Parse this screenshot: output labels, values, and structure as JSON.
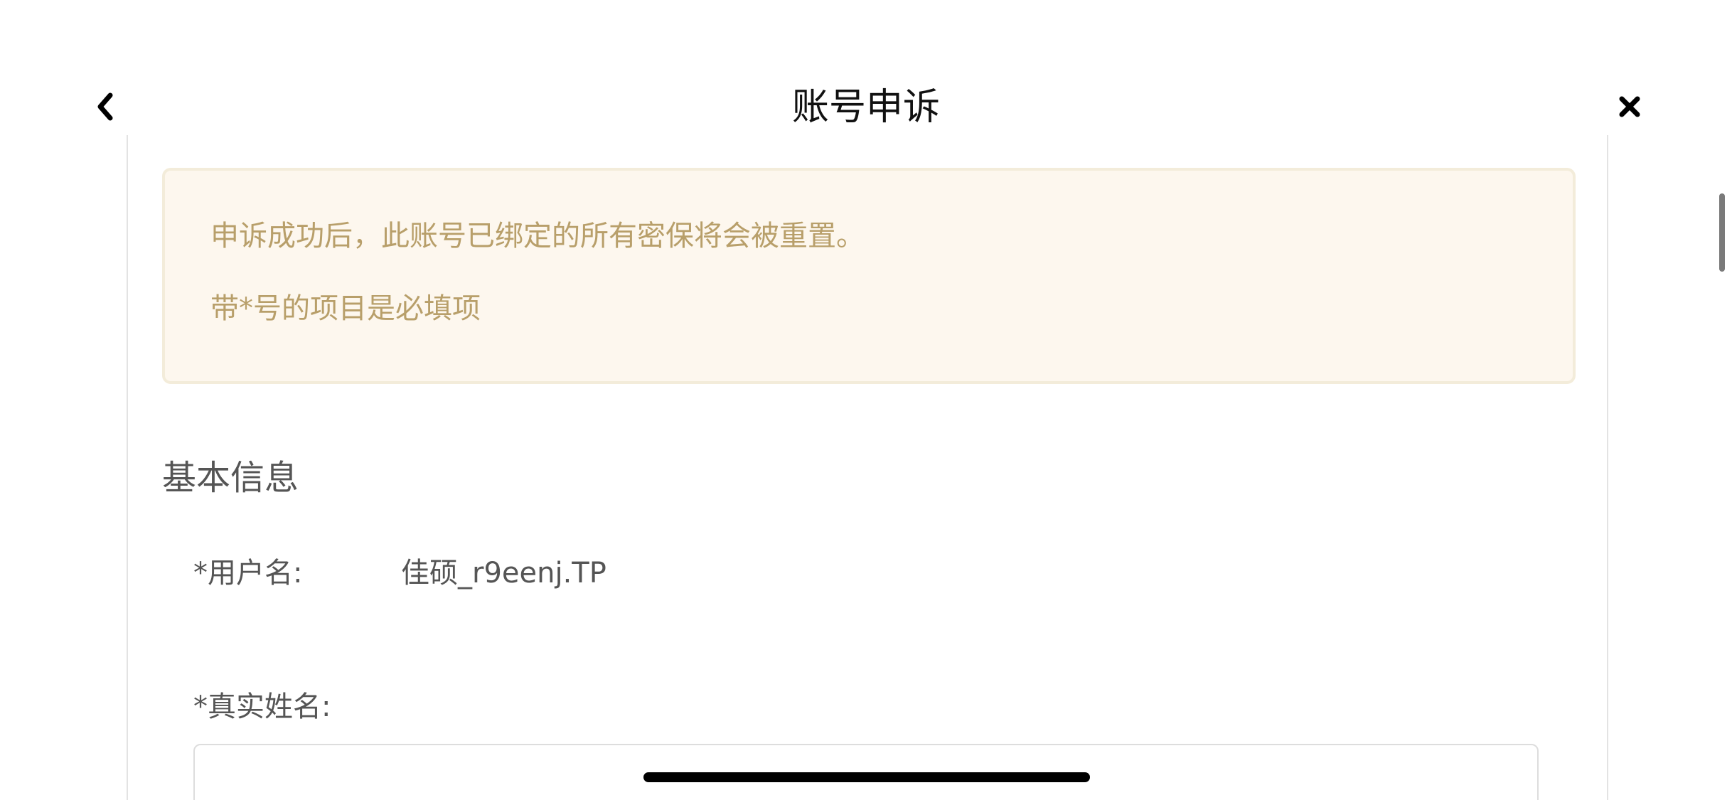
{
  "header": {
    "title": "账号申诉",
    "back_icon": "chevron-left-icon",
    "close_icon": "close-icon"
  },
  "notice": {
    "line1": "申诉成功后，此账号已绑定的所有密保将会被重置。",
    "line2": "带*号的项目是必填项"
  },
  "section": {
    "title": "基本信息"
  },
  "form": {
    "username_label": "*用户名:",
    "username_value": "佳硕_r9eenj.TP",
    "realname_label": "*真实姓名:",
    "realname_value": ""
  },
  "colors": {
    "notice_background": "#fdf7ee",
    "notice_text": "#b89f6a",
    "label_text": "#555555"
  }
}
